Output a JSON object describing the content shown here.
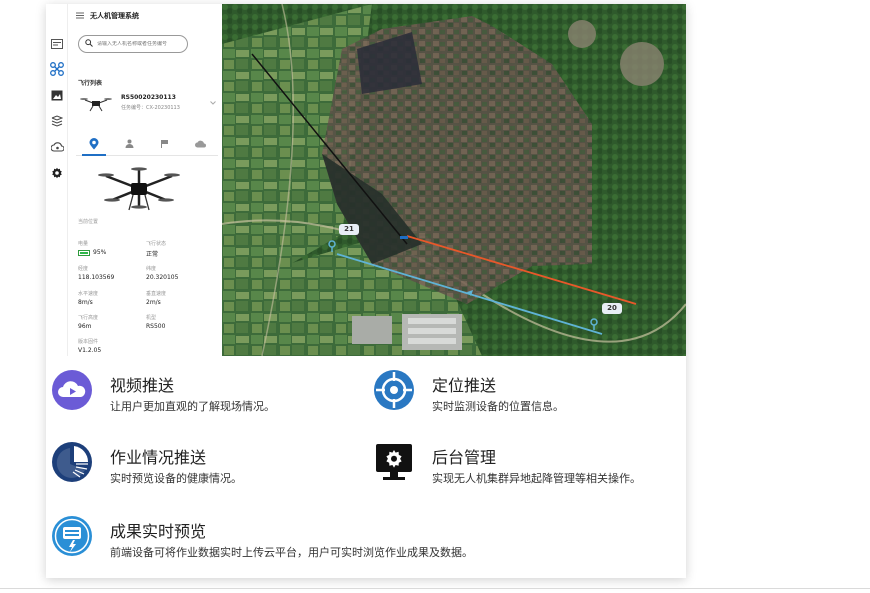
{
  "app": {
    "title": "无人机管理系统"
  },
  "search": {
    "placeholder": "请输入无人机名称或者任务编号"
  },
  "flight_list": {
    "title": "飞行列表",
    "drone_id": "RS50020230113",
    "task_number": "任务编号：CX-20230113"
  },
  "detail": {
    "location_label": "当前位置",
    "battery_label": "电量",
    "battery_value": "95%",
    "status_label": "飞行状态",
    "status_value": "正常",
    "longitude_label": "经度",
    "longitude_value": "118.103569",
    "latitude_label": "纬度",
    "latitude_value": "20.320105",
    "hspeed_label": "水平速度",
    "hspeed_value": "8m/s",
    "vspeed_label": "垂直速度",
    "vspeed_value": "2m/s",
    "altitude_label": "飞行高度",
    "altitude_value": "96m",
    "model_label": "机型",
    "model_value": "RS500",
    "firmware_label": "版本固件",
    "firmware_value": "V1.2.05"
  },
  "map": {
    "marker_a": "21",
    "marker_b": "20",
    "track_colors": {
      "blue": "#5fb3d6",
      "orange": "#e8582a",
      "dark": "#1a1a1a"
    }
  },
  "features": [
    {
      "title": "视频推送",
      "desc": "让用户更加直观的了解现场情况。",
      "icon": "cloud-play-icon"
    },
    {
      "title": "定位推送",
      "desc": "实时监测设备的位置信息。",
      "icon": "crosshair-icon"
    },
    {
      "title": "作业情况推送",
      "desc": "实时预览设备的健康情况。",
      "icon": "pie-chart-icon"
    },
    {
      "title": "后台管理",
      "desc": "实现无人机集群异地起降管理等相关操作。",
      "icon": "monitor-gear-icon"
    },
    {
      "title": "成果实时预览",
      "desc": "前端设备可将作业数据实时上传云平台，用户可实时浏览作业成果及数据。",
      "icon": "upload-device-icon"
    }
  ],
  "colors": {
    "accent": "#1f6fc5",
    "navy": "#1d3f7a",
    "icon_purple": "#6b5bd6",
    "icon_blue": "#2a78c2"
  }
}
